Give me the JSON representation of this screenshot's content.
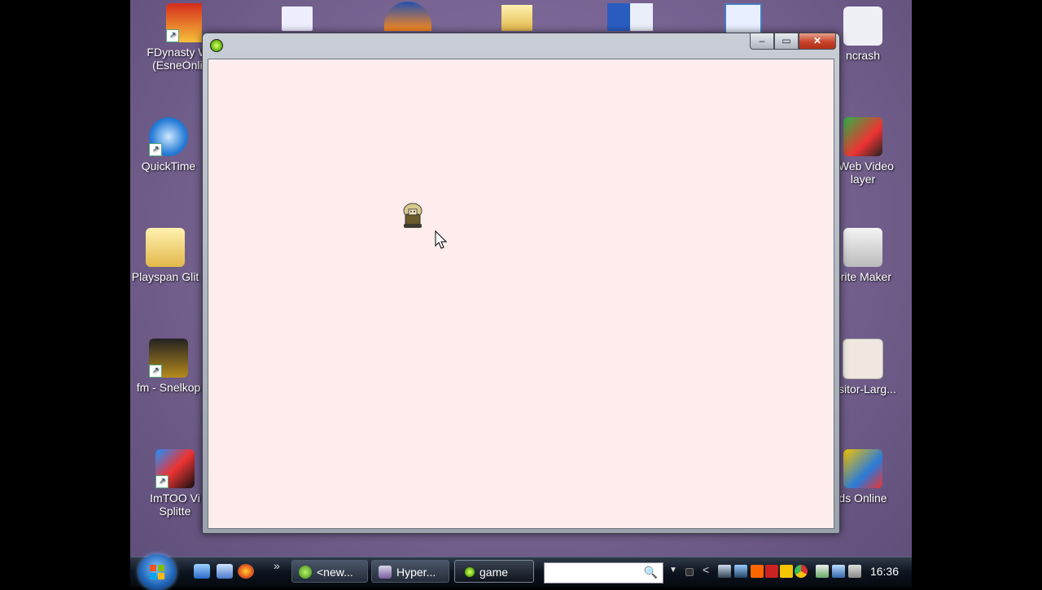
{
  "desktop": {
    "left_icons": [
      {
        "label": "FDynasty Wa...",
        "label2": "(EsneOnline)"
      },
      {
        "label": "QuickTime",
        "label2": ""
      },
      {
        "label": "Playspan Glit",
        "label2": ""
      },
      {
        "label": "fm - Snelkop",
        "label2": ""
      },
      {
        "label": "ImTOO Vi",
        "label2": "Splitte"
      }
    ],
    "right_icons": [
      {
        "label": "ncrash",
        "label2": ""
      },
      {
        "label": "t Web Video",
        "label2": "layer"
      },
      {
        "label": "prite Maker",
        "label2": ""
      },
      {
        "label": "uisitor-Larg...",
        "label2": ""
      },
      {
        "label": "ds Online",
        "label2": ""
      }
    ]
  },
  "window": {
    "caption_buttons": {
      "minimize": "‒",
      "maximize": "▭",
      "close": "✕"
    }
  },
  "taskbar": {
    "overflow_label": "»",
    "buttons": [
      {
        "label": "<new...",
        "icon": "g-icon"
      },
      {
        "label": "Hyper...",
        "icon": "hyper-icon"
      },
      {
        "label": "game",
        "icon": "game-icon"
      }
    ],
    "search_icon": "🔍",
    "tray_arrow": "<",
    "clock": "16:36"
  },
  "colors": {
    "client_bg": "#ffecec",
    "desktop": "#7a6694"
  }
}
